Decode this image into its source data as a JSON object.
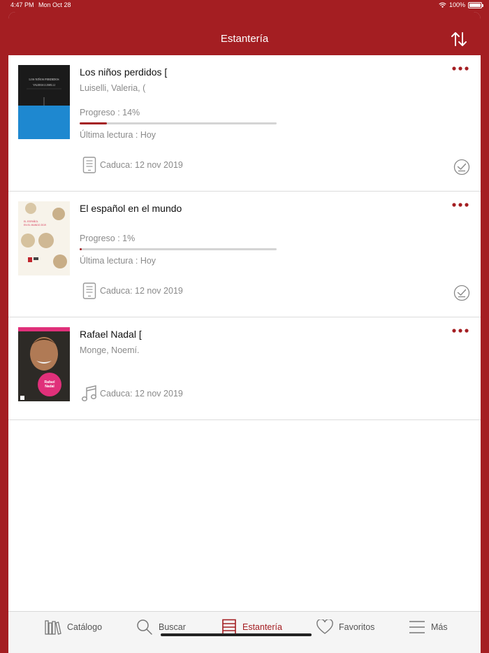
{
  "status_bar": {
    "time": "4:47 PM",
    "date": "Mon Oct 28",
    "battery": "100%"
  },
  "navbar": {
    "title": "Estantería",
    "sort_icon": "sort-arrows-icon"
  },
  "books": [
    {
      "title": "Los niños perdidos [",
      "author": "Luiselli, Valeria, (",
      "progress_label": "Progreso : 14%",
      "progress": 0.14,
      "last_read": "Última lectura : Hoy",
      "expiry": "Caduca: 12 nov 2019",
      "format_icon": "ebook-icon",
      "downloaded": true,
      "cover": {
        "top_color": "#1a1a1a",
        "bottom_color": "#1e88d0",
        "title_text": "LOS NIÑOS PERDIDOS",
        "author_text": "VALERIA LUISELLI"
      }
    },
    {
      "title": "El español en el mundo",
      "author": "",
      "progress_label": "Progreso : 1%",
      "progress": 0.01,
      "last_read": "Última lectura : Hoy",
      "expiry": "Caduca: 12 nov 2019",
      "format_icon": "ebook-icon",
      "downloaded": true,
      "cover": {
        "bg_color": "#f7f3ea",
        "title_text": "EL ESPAÑOL EN EL MUNDO 2019",
        "accent": "#d63354"
      }
    },
    {
      "title": "Rafael Nadal [",
      "author": "Monge, Noemí.",
      "expiry": "Caduca: 12 nov 2019",
      "format_icon": "music-note-icon",
      "cover": {
        "badge_text": "Rafael Nadal",
        "accent": "#e0307a"
      }
    }
  ],
  "tabbar": {
    "tabs": [
      {
        "label": "Catálogo",
        "icon": "books-icon"
      },
      {
        "label": "Buscar",
        "icon": "search-icon"
      },
      {
        "label": "Estantería",
        "icon": "shelf-icon",
        "active": true
      },
      {
        "label": "Favoritos",
        "icon": "heart-icon"
      },
      {
        "label": "Más",
        "icon": "menu-icon"
      }
    ]
  },
  "colors": {
    "brand": "#a41e22",
    "text_secondary": "#8a8a8a"
  }
}
